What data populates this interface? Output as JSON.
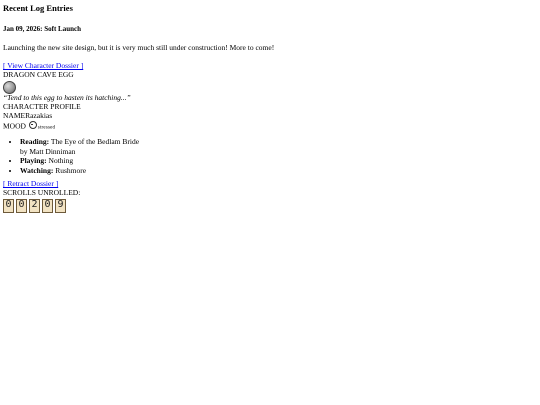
{
  "log": {
    "heading": "Recent Log Entries",
    "entry_title": "Jan 09, 2026: Soft Launch",
    "entry_text": "Launching the new site design, but it is very much still under construction! More to come!"
  },
  "dossier": {
    "view_link": "[ View Character Dossier ]",
    "egg_title": "DRAGON CAVE EGG",
    "egg_quote": "“Tend to this egg to hasten its hatching...”",
    "profile_title": "CHARACTER PROFILE",
    "name_label": "NAME",
    "name_value": "Razakias",
    "mood_label": "MOOD",
    "mood_value": "stressed",
    "media": [
      {
        "label": "Reading:",
        "value": "The Eye of the Bedlam Bride",
        "sub": "by Matt Dinniman"
      },
      {
        "label": "Playing:",
        "value": "Nothing"
      },
      {
        "label": "Watching:",
        "value": "Rushmore"
      }
    ],
    "retract_link": "[ Retract Dossier ]"
  },
  "counter": {
    "label": "SCROLLS UNROLLED:",
    "digits": [
      "0",
      "0",
      "2",
      "0",
      "9"
    ]
  }
}
